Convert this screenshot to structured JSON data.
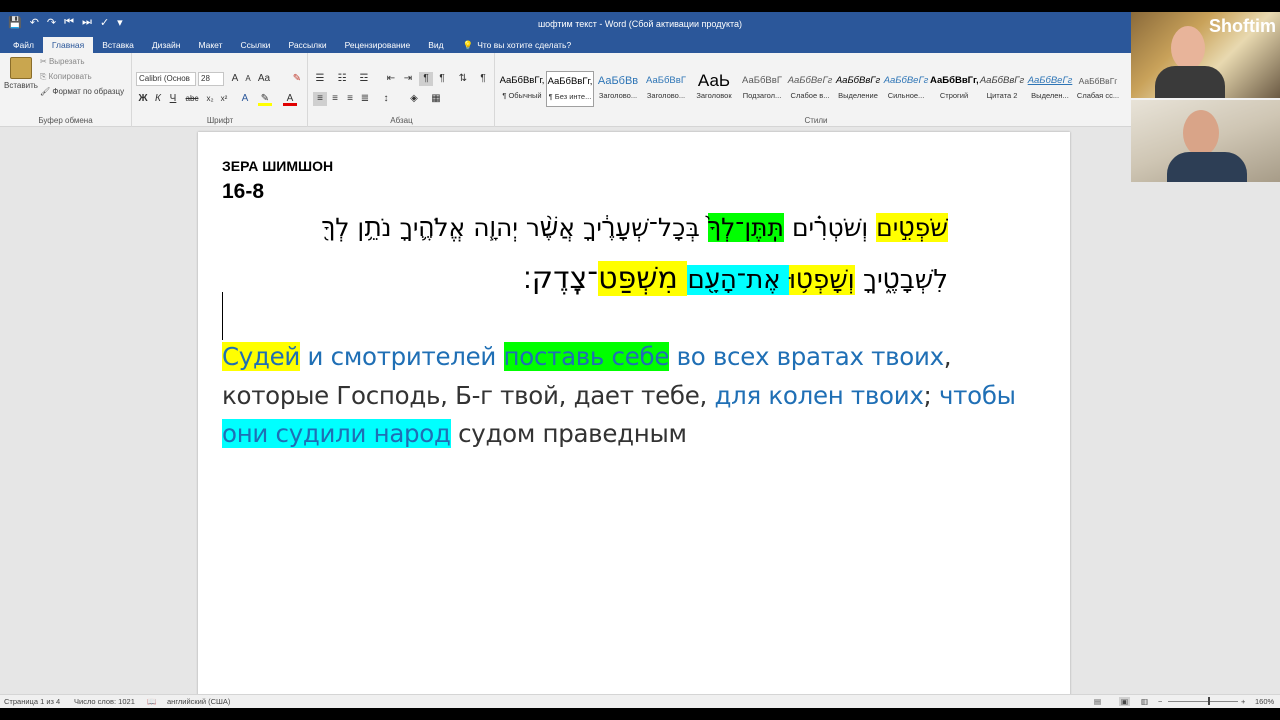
{
  "titlebar": {
    "title": "шофтим текст - Word (Сбой активации продукта)",
    "qat": [
      "💾",
      "↶",
      "↷",
      "⏮",
      "⏭",
      "✓",
      "▾"
    ]
  },
  "tabs": [
    "Файл",
    "Главная",
    "Вставка",
    "Дизайн",
    "Макет",
    "Ссылки",
    "Рассылки",
    "Рецензирование",
    "Вид"
  ],
  "tell_me": "Что вы хотите сделать?",
  "ribbon": {
    "clipboard": {
      "paste": "Вставить",
      "cut": "Вырезать",
      "copy": "Копировать",
      "format_painter": "Формат по образцу",
      "label": "Буфер обмена"
    },
    "font": {
      "family": "Calibri (Основ",
      "size": "28",
      "label": "Шрифт"
    },
    "paragraph": {
      "label": "Абзац"
    },
    "styles": {
      "label": "Стили",
      "items": [
        {
          "sample": "АаБбВвГг,",
          "name": "¶ Обычный"
        },
        {
          "sample": "АаБбВвГг,",
          "name": "¶ Без инте..."
        },
        {
          "sample": "АаБбВв",
          "name": "Заголово..."
        },
        {
          "sample": "АаБбВвГ",
          "name": "Заголово..."
        },
        {
          "sample": "АаЬ",
          "name": "Заголовок"
        },
        {
          "sample": "АаБбВвГ",
          "name": "Подзагол..."
        },
        {
          "sample": "АаБбВеГг",
          "name": "Слабое в..."
        },
        {
          "sample": "АаБбВвГг",
          "name": "Выделение"
        },
        {
          "sample": "АаБбВеГг",
          "name": "Сильное..."
        },
        {
          "sample": "АаБбВвГг,",
          "name": "Строгий"
        },
        {
          "sample": "АаБбВвГг",
          "name": "Цитата 2"
        },
        {
          "sample": "АаБбВеГг",
          "name": "Выделен..."
        },
        {
          "sample": "АаБбВвГг",
          "name": "Слабая сс..."
        }
      ]
    }
  },
  "document": {
    "heading1": "ЗЕРА ШИМШОН",
    "heading2": "16-8",
    "hebrew_line1": {
      "p1": "שֹׁפְטִ֣ים",
      "p2": " וְשֹׁטְרִ֗ים ",
      "p3": "תִּֽתֶּן־לְךָ֙",
      "p4": " בְּכָל־שְׁעָרֶ֔יךָ אֲשֶׁ֨ר יְהוָ֧ה אֱלֹהֶ֛יךָ נֹתֵ֥ן לְךָ֖"
    },
    "hebrew_line2": {
      "p1": "לִשְׁבָטֶ֑יךָ ",
      "p2": "וְשָׁפְט֥וּ",
      "p3": " אֶת־הָעָ֖ם",
      "p4": " מִשְׁפַּט",
      "p5": "־צֶֽדֶק׃"
    },
    "russian_line1": {
      "a": "Судей",
      "b": " и смотрителей ",
      "c": "поставь себе",
      "d": " во всех вратах твоих",
      "e": ","
    },
    "russian_line2": {
      "a": "которые Господь, Б-г твой, дает тебе, ",
      "b": "для колен твоих",
      "c": "; ",
      "d": "чтобы"
    },
    "russian_line3": {
      "a": "они судили народ",
      "b": " судом праведным"
    }
  },
  "statusbar": {
    "page": "Страница 1 из 4",
    "words": "Число слов: 1021",
    "language": "английский (США)",
    "zoom": "160%"
  },
  "webcam": {
    "name_overlay": "Shoftim"
  }
}
